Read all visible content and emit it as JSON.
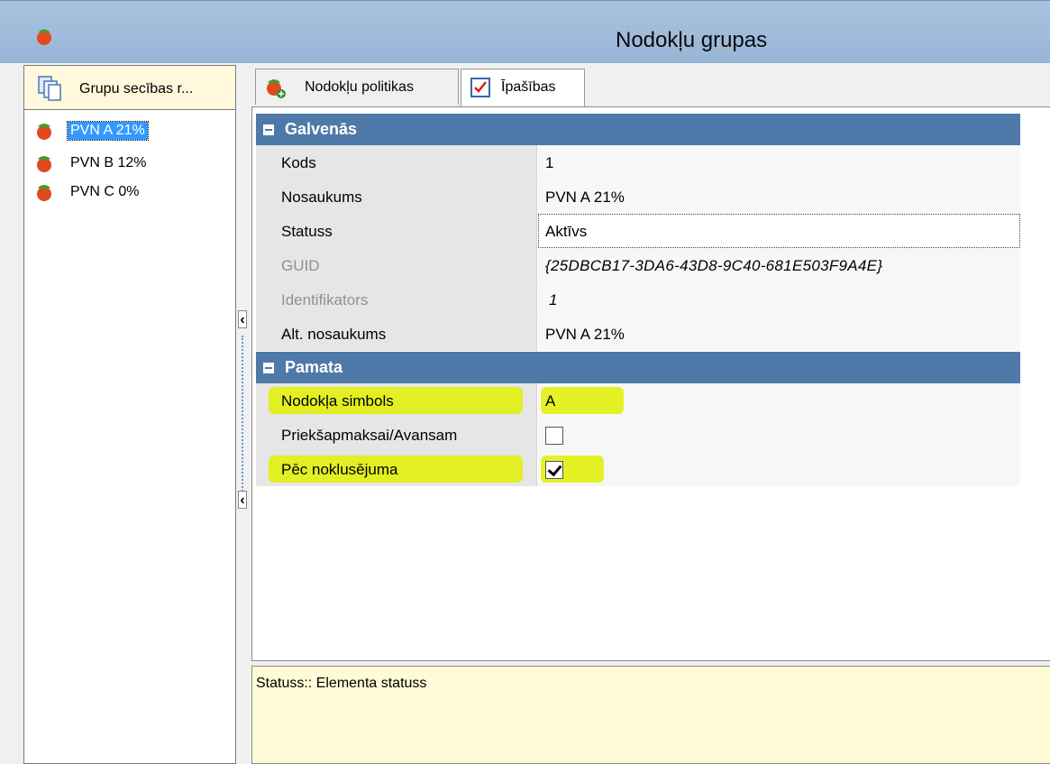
{
  "window": {
    "title": "Nodokļu grupas",
    "icon": "tomato-icon"
  },
  "left_panel": {
    "header_label": "Grupu secības r...",
    "header_icon": "copy-documents-icon",
    "items": [
      {
        "label": "PVN A 21%",
        "selected": true,
        "icon": "tomato-icon"
      },
      {
        "label": "PVN B 12%",
        "selected": false,
        "icon": "tomato-icon"
      },
      {
        "label": "PVN C 0%",
        "selected": false,
        "icon": "tomato-icon"
      }
    ]
  },
  "tabs": [
    {
      "label": "Nodokļu politikas",
      "icon": "tomato-plus-icon",
      "active": false
    },
    {
      "label": "Īpašības",
      "icon": "checklist-icon",
      "active": true
    }
  ],
  "property_grid": {
    "categories": [
      {
        "label": "Galvenās",
        "rows": [
          {
            "name": "Kods",
            "value": "1"
          },
          {
            "name": "Nosaukums",
            "value": "PVN A 21%"
          },
          {
            "name": "Statuss",
            "value": "Aktīvs"
          },
          {
            "name": "GUID",
            "value": "{25DBCB17-3DA6-43D8-9C40-681E503F9A4E}"
          },
          {
            "name": "Identifikators",
            "value": "1"
          },
          {
            "name": "Alt. nosaukums",
            "value": "PVN A 21%"
          }
        ]
      },
      {
        "label": "Pamata",
        "rows": [
          {
            "name": "Nodokļa simbols",
            "value": "A"
          },
          {
            "name": "Priekšapmaksai/Avansam",
            "checked": false
          },
          {
            "name": "Pēc noklusējuma",
            "checked": true
          }
        ]
      }
    ]
  },
  "description": "Statuss:: Elementa statuss",
  "colors": {
    "title_bar": "#a9c3df",
    "category_bar": "#4f79a8",
    "selection": "#3399ff",
    "highlight": "#e1f000",
    "description_bg": "#fffbd6"
  }
}
